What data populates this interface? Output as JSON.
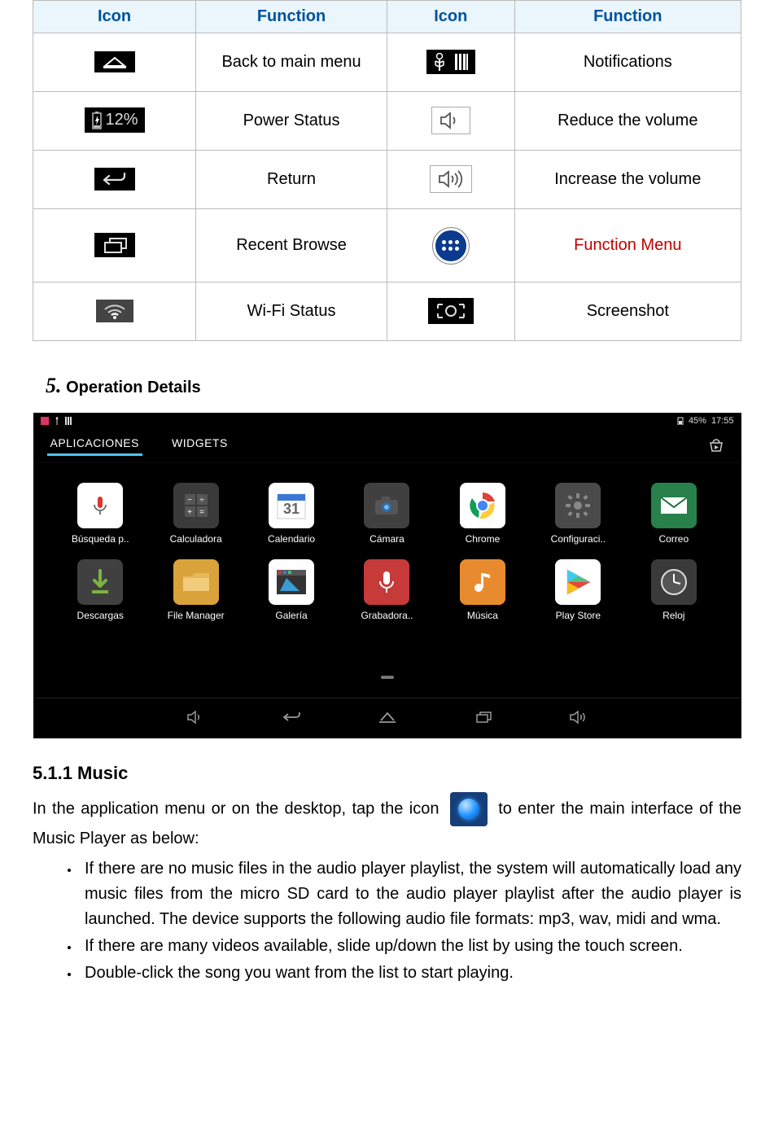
{
  "table": {
    "headers": [
      "Icon",
      "Function",
      "Icon",
      "Function"
    ],
    "rows": [
      {
        "func1": "Back to main menu",
        "func2": "Notifications"
      },
      {
        "func1": "Power Status",
        "func2": "Reduce the volume"
      },
      {
        "func1": "Return",
        "func2": "Increase the volume"
      },
      {
        "func1": "Recent Browse",
        "func2": "Function Menu"
      },
      {
        "func1": "Wi-Fi Status",
        "func2": "Screenshot"
      }
    ],
    "battery_pct": "12%"
  },
  "section5": {
    "num": "5.",
    "title": "Operation Details"
  },
  "tablet": {
    "status": {
      "battery": "45%",
      "time": "17:55"
    },
    "tabs": {
      "apps": "APLICACIONES",
      "widgets": "WIDGETS"
    },
    "apps": [
      {
        "label": "Búsqueda p..",
        "bg": "#fff",
        "glyph": "mic"
      },
      {
        "label": "Calculadora",
        "bg": "#3a3a3a",
        "glyph": "calc"
      },
      {
        "label": "Calendario",
        "bg": "#fff",
        "glyph": "cal",
        "txt": "31"
      },
      {
        "label": "Cámara",
        "bg": "#404040",
        "glyph": "cam"
      },
      {
        "label": "Chrome",
        "bg": "#fff",
        "glyph": "chrome"
      },
      {
        "label": "Configuraci..",
        "bg": "#4a4a4a",
        "glyph": "gear"
      },
      {
        "label": "Correo",
        "bg": "#28804a",
        "glyph": "mail"
      },
      {
        "label": "Descargas",
        "bg": "#404040",
        "glyph": "dl"
      },
      {
        "label": "File Manager",
        "bg": "#d9a23a",
        "glyph": "folder"
      },
      {
        "label": "Galería",
        "bg": "#fff",
        "glyph": "gallery"
      },
      {
        "label": "Grabadora..",
        "bg": "#c73a3a",
        "glyph": "rec"
      },
      {
        "label": "Música",
        "bg": "#e88b2f",
        "glyph": "music"
      },
      {
        "label": "Play Store",
        "bg": "#fff",
        "glyph": "play"
      },
      {
        "label": "Reloj",
        "bg": "#3a3a3a",
        "glyph": "clock"
      }
    ]
  },
  "music": {
    "heading": "5.1.1 Music",
    "intro_before": "In the application menu or on the desktop, tap the icon ",
    "intro_after": " to enter the main interface of the Music Player as below:",
    "bullets": [
      "If there are no music files in the audio player playlist, the system will automatically load any music files from the micro SD card to the audio player playlist after the audio player is launched. The device supports the following audio file formats: mp3, wav, midi and wma.",
      "If there are many videos available, slide up/down the list by using the touch screen.",
      "Double-click the song you want from the list to start playing."
    ]
  }
}
